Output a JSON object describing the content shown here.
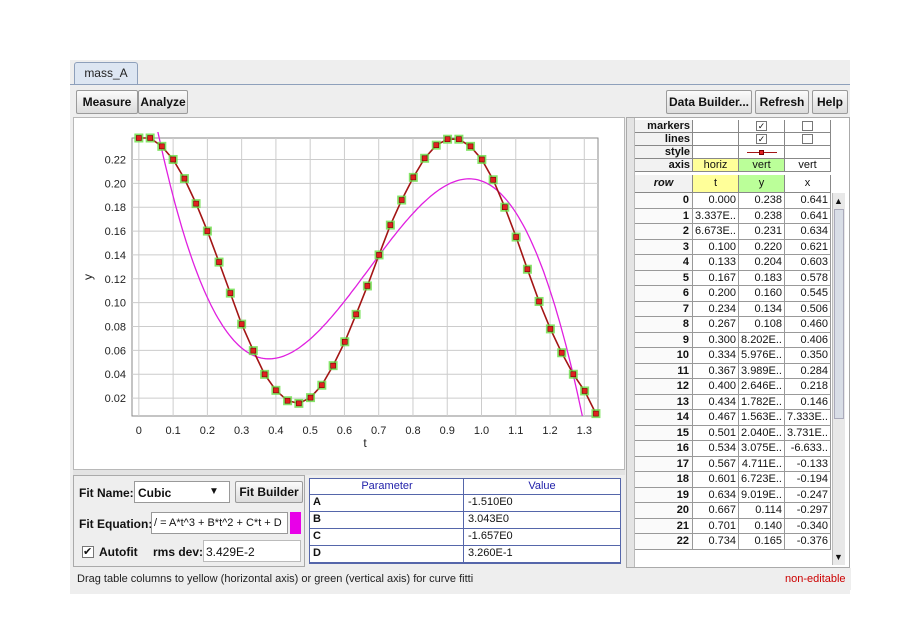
{
  "tab": {
    "label": "mass_A"
  },
  "toolbar": {
    "measure_label": "Measure",
    "analyze_label": "Analyze",
    "data_builder_label": "Data Builder...",
    "refresh_label": "Refresh",
    "help_label": "Help"
  },
  "chart_data": {
    "type": "scatter",
    "xlabel": "t",
    "ylabel": "y",
    "xlim": [
      -0.02,
      1.34
    ],
    "ylim": [
      0.005,
      0.238
    ],
    "xticks": [
      "0",
      "0.1",
      "0.2",
      "0.3",
      "0.4",
      "0.5",
      "0.6",
      "0.7",
      "0.8",
      "0.9",
      "1.0",
      "1.1",
      "1.2",
      "1.3"
    ],
    "yticks": [
      "0.02",
      "0.04",
      "0.06",
      "0.08",
      "0.10",
      "0.12",
      "0.14",
      "0.16",
      "0.18",
      "0.20",
      "0.22"
    ],
    "grid": true,
    "series": [
      {
        "style": "markers+lines",
        "line_color": "#a31515",
        "marker_color": "#e02020",
        "marker_halo": "#66dd44",
        "x": [
          0.0,
          0.033,
          0.067,
          0.1,
          0.133,
          0.167,
          0.2,
          0.234,
          0.267,
          0.3,
          0.334,
          0.367,
          0.4,
          0.434,
          0.467,
          0.501,
          0.534,
          0.567,
          0.601,
          0.634,
          0.667,
          0.701,
          0.734,
          0.767,
          0.801,
          0.834,
          0.868,
          0.901,
          0.934,
          0.968,
          1.001,
          1.034,
          1.068,
          1.101,
          1.134,
          1.168,
          1.201,
          1.234,
          1.268,
          1.301,
          1.334
        ],
        "y": [
          0.238,
          0.238,
          0.231,
          0.22,
          0.204,
          0.183,
          0.16,
          0.134,
          0.108,
          0.082,
          0.0598,
          0.0399,
          0.0265,
          0.0178,
          0.0156,
          0.0204,
          0.0308,
          0.0472,
          0.0672,
          0.0902,
          0.114,
          0.14,
          0.165,
          0.186,
          0.205,
          0.221,
          0.232,
          0.237,
          0.237,
          0.231,
          0.22,
          0.203,
          0.18,
          0.155,
          0.128,
          0.101,
          0.078,
          0.058,
          0.04,
          0.026,
          0.007
        ]
      },
      {
        "style": "line",
        "color": "#e020e0",
        "fit": "cubic",
        "coefficients": {
          "A": -1.51,
          "B": 3.043,
          "C": -1.657,
          "D": 0.326
        },
        "x_range": [
          0,
          1.32
        ]
      }
    ]
  },
  "fit": {
    "name_label": "Fit Name:",
    "name_value": "Cubic",
    "builder_label": "Fit Builder",
    "equation_label": "Fit Equation:",
    "equation_value": "/ = A*t^3 + B*t^2 + C*t + D",
    "equation_color": "#e800e8",
    "autofit_label": "Autofit",
    "autofit_checked": true,
    "rms_label": "rms dev:",
    "rms_value": "3.429E-2",
    "param_header": "Parameter",
    "value_header": "Value",
    "params": [
      {
        "name": "A",
        "value": "-1.510E0"
      },
      {
        "name": "B",
        "value": "3.043E0"
      },
      {
        "name": "C",
        "value": "-1.657E0"
      },
      {
        "name": "D",
        "value": "3.260E-1"
      }
    ]
  },
  "table": {
    "style_rows": [
      "markers",
      "lines",
      "style",
      "axis"
    ],
    "markers_checked": [
      true,
      false
    ],
    "lines_checked": [
      true,
      false
    ],
    "axis_values": [
      "horiz",
      "vert",
      "vert"
    ],
    "axis_colors": [
      "#ffff99",
      "#bbff99",
      "#ffffff"
    ],
    "row_header": "row",
    "columns": [
      "t",
      "y",
      "x"
    ],
    "rows": [
      [
        "0",
        "0.000",
        "0.238",
        "0.641"
      ],
      [
        "1",
        "3.337E..",
        "0.238",
        "0.641"
      ],
      [
        "2",
        "6.673E..",
        "0.231",
        "0.634"
      ],
      [
        "3",
        "0.100",
        "0.220",
        "0.621"
      ],
      [
        "4",
        "0.133",
        "0.204",
        "0.603"
      ],
      [
        "5",
        "0.167",
        "0.183",
        "0.578"
      ],
      [
        "6",
        "0.200",
        "0.160",
        "0.545"
      ],
      [
        "7",
        "0.234",
        "0.134",
        "0.506"
      ],
      [
        "8",
        "0.267",
        "0.108",
        "0.460"
      ],
      [
        "9",
        "0.300",
        "8.202E..",
        "0.406"
      ],
      [
        "10",
        "0.334",
        "5.976E..",
        "0.350"
      ],
      [
        "11",
        "0.367",
        "3.989E..",
        "0.284"
      ],
      [
        "12",
        "0.400",
        "2.646E..",
        "0.218"
      ],
      [
        "13",
        "0.434",
        "1.782E..",
        "0.146"
      ],
      [
        "14",
        "0.467",
        "1.563E..",
        "7.333E.."
      ],
      [
        "15",
        "0.501",
        "2.040E..",
        "3.731E.."
      ],
      [
        "16",
        "0.534",
        "3.075E..",
        "-6.633.."
      ],
      [
        "17",
        "0.567",
        "4.711E..",
        "-0.133"
      ],
      [
        "18",
        "0.601",
        "6.723E..",
        "-0.194"
      ],
      [
        "19",
        "0.634",
        "9.019E..",
        "-0.247"
      ],
      [
        "20",
        "0.667",
        "0.114",
        "-0.297"
      ],
      [
        "21",
        "0.701",
        "0.140",
        "-0.340"
      ],
      [
        "22",
        "0.734",
        "0.165",
        "-0.376"
      ]
    ]
  },
  "status": {
    "message": "Drag table columns to yellow (horizontal axis) or green (vertical axis) for curve fitti",
    "right": "non-editable"
  }
}
